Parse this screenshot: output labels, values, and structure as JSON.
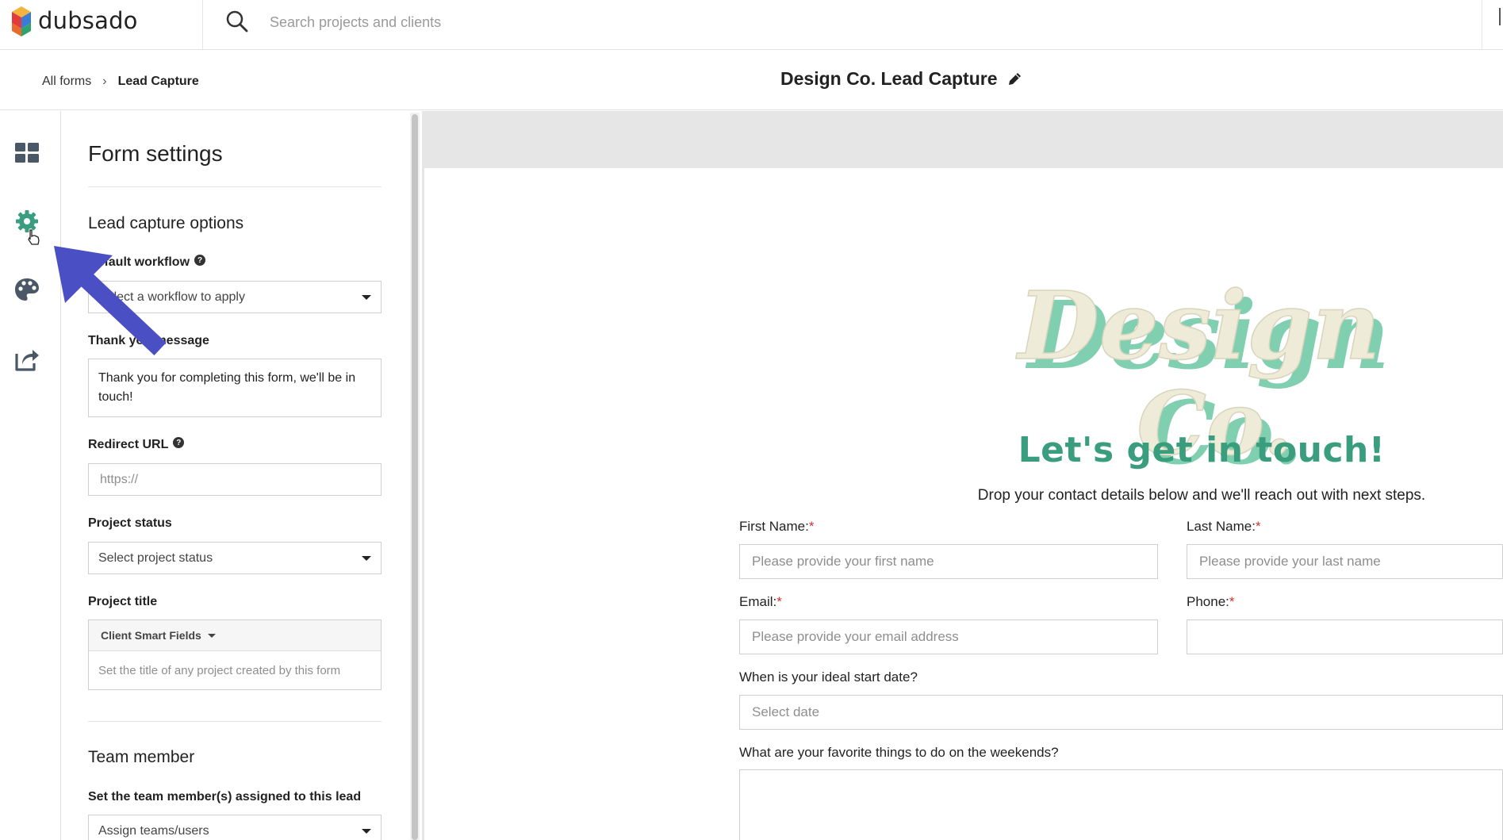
{
  "app": {
    "brand_name": "dubsado"
  },
  "search": {
    "placeholder": "Search projects and clients"
  },
  "breadcrumb": {
    "root": "All forms",
    "separator": "›",
    "current": "Lead Capture"
  },
  "page": {
    "title": "Design Co. Lead Capture"
  },
  "rail": {
    "icons": [
      "dashboard-grid-icon",
      "gear-icon",
      "palette-icon",
      "share-icon"
    ],
    "accent": "#3a9d7e"
  },
  "settings": {
    "title": "Form settings",
    "lead_capture_title": "Lead capture options",
    "default_workflow": {
      "label": "Default workflow",
      "value": "Select a workflow to apply"
    },
    "thank_you": {
      "label": "Thank you message",
      "value": "Thank you for completing this form, we'll be in touch!"
    },
    "redirect": {
      "label": "Redirect URL",
      "placeholder": "https://"
    },
    "project_status": {
      "label": "Project status",
      "value": "Select project status"
    },
    "project_title": {
      "label": "Project title",
      "smart_fields": "Client Smart Fields",
      "placeholder": "Set the title of any project created by this form"
    },
    "team_member": {
      "title": "Team member",
      "label": "Set the team member(s) assigned to this lead",
      "value": "Assign teams/users"
    }
  },
  "preview": {
    "logo_text": "Design Co.",
    "headline": "Let's get in touch!",
    "subline": "Drop your contact details below and we'll reach out with next steps.",
    "first_name": {
      "label": "First Name:",
      "required": "*",
      "placeholder": "Please provide your first name"
    },
    "last_name": {
      "label": "Last Name:",
      "required": "*",
      "placeholder": "Please provide your last name"
    },
    "email": {
      "label": "Email:",
      "required": "*",
      "placeholder": "Please provide your email address"
    },
    "phone": {
      "label": "Phone:",
      "required": "*",
      "placeholder": ""
    },
    "start_date": {
      "label": "When is your ideal start date?",
      "placeholder": "Select date"
    },
    "weekends": {
      "label": "What are your favorite things to do on the weekends?"
    },
    "accent": "#3a9d7e"
  },
  "annotation": {
    "arrow_color": "#4a4fc4"
  }
}
